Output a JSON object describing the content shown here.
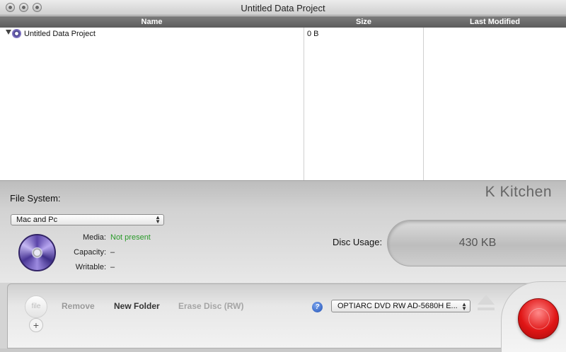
{
  "window": {
    "title": "Untitled Data Project"
  },
  "columns": {
    "name": "Name",
    "size": "Size",
    "last_modified": "Last Modified"
  },
  "rows": [
    {
      "name": "Untitled Data Project",
      "size": "0 B",
      "last_modified": "",
      "icon": "data-project-disc-icon"
    }
  ],
  "filesystem": {
    "label": "File System:",
    "selected": "Mac and Pc"
  },
  "branding": {
    "text": "K Kitchen"
  },
  "disc_info": {
    "media_label": "Media:",
    "media_value": "Not present",
    "capacity_label": "Capacity:",
    "capacity_value": "–",
    "writable_label": "Writable:",
    "writable_value": "–"
  },
  "disc_usage": {
    "label": "Disc Usage:",
    "value": "430 KB"
  },
  "toolbar": {
    "file_label": "file",
    "remove_label": "Remove",
    "new_folder_label": "New Folder",
    "erase_label": "Erase Disc (RW)",
    "help_label": "?",
    "drive_selected": "OPTIARC DVD RW AD-5680H E..."
  },
  "colors": {
    "media_status": "#2a9a2a",
    "burn_button": "#e01616",
    "header_bg": "#6a6a6a"
  }
}
